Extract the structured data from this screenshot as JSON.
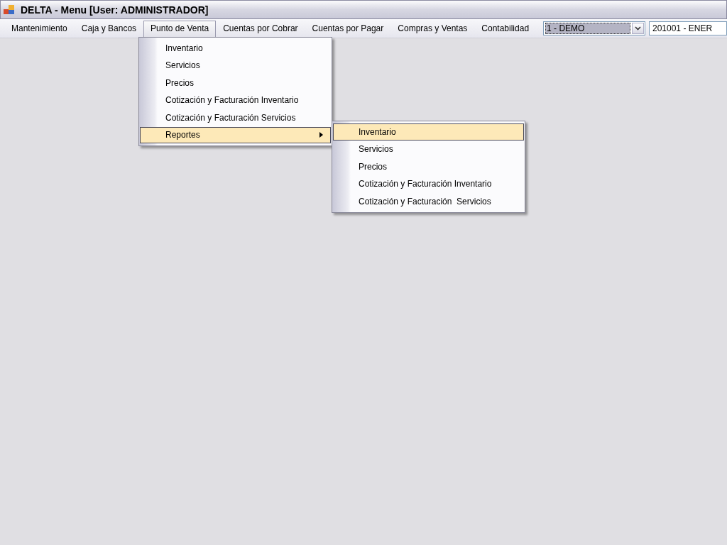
{
  "window": {
    "title": "DELTA - Menu [User: ADMINISTRADOR]"
  },
  "menubar": [
    {
      "label": "Mantenimiento",
      "selected": false
    },
    {
      "label": "Caja y Bancos",
      "selected": false
    },
    {
      "label": "Punto de Venta",
      "selected": true
    },
    {
      "label": "Cuentas por Cobrar",
      "selected": false
    },
    {
      "label": "Cuentas por Pagar",
      "selected": false
    },
    {
      "label": "Compras y Ventas",
      "selected": false
    },
    {
      "label": "Contabilidad",
      "selected": false
    }
  ],
  "company_combo": {
    "value": "1 - DEMO"
  },
  "period_combo": {
    "value": "201001 - ENER"
  },
  "menu": [
    {
      "label": "Inventario",
      "selected": false,
      "submenu": false
    },
    {
      "label": "Servicios",
      "selected": false,
      "submenu": false
    },
    {
      "label": "Precios",
      "selected": false,
      "submenu": false
    },
    {
      "label": "Cotización y Facturación Inventario",
      "selected": false,
      "submenu": false
    },
    {
      "label": "Cotización y Facturación Servicios",
      "selected": false,
      "submenu": false
    },
    {
      "label": "Reportes",
      "selected": true,
      "submenu": true
    }
  ],
  "submenu": [
    {
      "label": "Inventario",
      "selected": true
    },
    {
      "label": "Servicios",
      "selected": false
    },
    {
      "label": "Precios",
      "selected": false
    },
    {
      "label": "Cotización y Facturación Inventario",
      "selected": false
    },
    {
      "label": "Cotización y Facturación  Servicios",
      "selected": false
    }
  ]
}
